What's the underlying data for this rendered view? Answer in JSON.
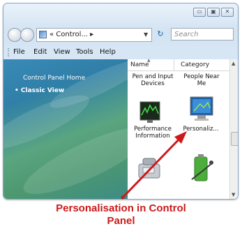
{
  "window": {
    "address_text": "« Control... ▸",
    "search_placeholder": "Search",
    "caption_buttons": [
      "▭",
      "▣",
      "✕"
    ]
  },
  "menu": [
    "File",
    "Edit",
    "View",
    "Tools",
    "Help"
  ],
  "sidebar": {
    "home_label": "Control Panel Home",
    "classic_label": "Classic View"
  },
  "columns": {
    "name": "Name",
    "category": "Category"
  },
  "items": [
    {
      "label": "Pen and Input Devices",
      "icon": "pen-tablet-icon"
    },
    {
      "label": "People Near Me",
      "icon": "people-icon"
    },
    {
      "label": "Performance Information",
      "icon": "performance-monitor-icon"
    },
    {
      "label": "Personaliz...",
      "icon": "personalization-monitor-icon"
    },
    {
      "label": "",
      "icon": "phone-modem-icon"
    },
    {
      "label": "",
      "icon": "power-options-icon"
    }
  ],
  "annotation": {
    "caption_line1": "Personalisation in Control",
    "caption_line2": "Panel",
    "arrow_color": "#cc1a1a"
  }
}
